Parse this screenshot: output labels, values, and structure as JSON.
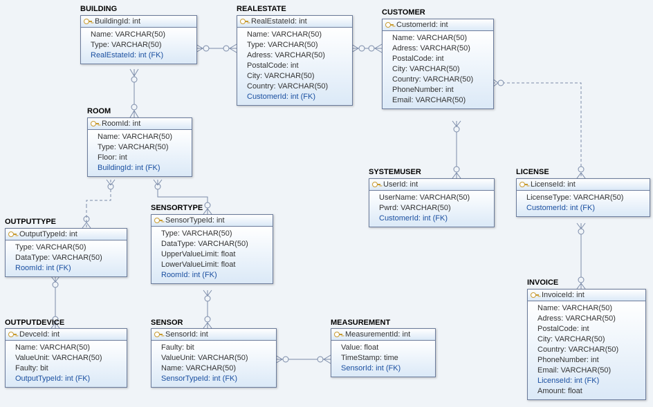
{
  "entities": {
    "building": {
      "title": "BUILDING",
      "pk": "BuildingId: int",
      "cols": [
        {
          "text": "Name: VARCHAR(50)",
          "fk": false
        },
        {
          "text": "Type: VARCHAR(50)",
          "fk": false
        },
        {
          "text": "RealEstateId: int (FK)",
          "fk": true
        }
      ]
    },
    "realestate": {
      "title": "REALESTATE",
      "pk": "RealEstateId: int",
      "cols": [
        {
          "text": "Name: VARCHAR(50)",
          "fk": false
        },
        {
          "text": "Type: VARCHAR(50)",
          "fk": false
        },
        {
          "text": "Adress: VARCHAR(50)",
          "fk": false
        },
        {
          "text": "PostalCode: int",
          "fk": false
        },
        {
          "text": "City: VARCHAR(50)",
          "fk": false
        },
        {
          "text": "Country: VARCHAR(50)",
          "fk": false
        },
        {
          "text": "CustomerId: int (FK)",
          "fk": true
        }
      ]
    },
    "customer": {
      "title": "CUSTOMER",
      "pk": "CustomerId: int",
      "cols": [
        {
          "text": "Name: VARCHAR(50)",
          "fk": false
        },
        {
          "text": "Adress: VARCHAR(50)",
          "fk": false
        },
        {
          "text": "PostalCode: int",
          "fk": false
        },
        {
          "text": "City: VARCHAR(50)",
          "fk": false
        },
        {
          "text": "Country: VARCHAR(50)",
          "fk": false
        },
        {
          "text": "PhoneNumber: int",
          "fk": false
        },
        {
          "text": "Email: VARCHAR(50)",
          "fk": false
        }
      ]
    },
    "room": {
      "title": "ROOM",
      "pk": "RoomId: int",
      "cols": [
        {
          "text": "Name: VARCHAR(50)",
          "fk": false
        },
        {
          "text": "Type: VARCHAR(50)",
          "fk": false
        },
        {
          "text": "Floor: int",
          "fk": false
        },
        {
          "text": "BuildingId: int (FK)",
          "fk": true
        }
      ]
    },
    "outputtype": {
      "title": "OUTPUTTYPE",
      "pk": "OutputTypeId: int",
      "cols": [
        {
          "text": "Type: VARCHAR(50)",
          "fk": false
        },
        {
          "text": "DataType: VARCHAR(50)",
          "fk": false
        },
        {
          "text": "RoomId: int (FK)",
          "fk": true
        }
      ]
    },
    "sensortype": {
      "title": "SENSORTYPE",
      "pk": "SensorTypeId: int",
      "cols": [
        {
          "text": "Type: VARCHAR(50)",
          "fk": false
        },
        {
          "text": "DataType: VARCHAR(50)",
          "fk": false
        },
        {
          "text": "UpperValueLimit: float",
          "fk": false
        },
        {
          "text": "LowerValueLimit: float",
          "fk": false
        },
        {
          "text": "RoomId: int (FK)",
          "fk": true
        }
      ]
    },
    "systemuser": {
      "title": "SYSTEMUSER",
      "pk": "UserId: int",
      "cols": [
        {
          "text": "UserName: VARCHAR(50)",
          "fk": false
        },
        {
          "text": "Pwrd: VARCHAR(50)",
          "fk": false
        },
        {
          "text": "CustomerId: int (FK)",
          "fk": true
        }
      ]
    },
    "license": {
      "title": "LICENSE",
      "pk": "LicenseId: int",
      "cols": [
        {
          "text": "LicenseType: VARCHAR(50)",
          "fk": false
        },
        {
          "text": "CustomerId: int (FK)",
          "fk": true
        }
      ]
    },
    "outputdevice": {
      "title": "OUTPUTDEVICE",
      "pk": "DevceId: int",
      "cols": [
        {
          "text": "Name: VARCHAR(50)",
          "fk": false
        },
        {
          "text": "ValueUnit: VARCHAR(50)",
          "fk": false
        },
        {
          "text": "Faulty: bit",
          "fk": false
        },
        {
          "text": "OutputTypeId: int (FK)",
          "fk": true
        }
      ]
    },
    "sensor": {
      "title": "SENSOR",
      "pk": "SensorId: int",
      "cols": [
        {
          "text": "Faulty: bit",
          "fk": false
        },
        {
          "text": "ValueUnit: VARCHAR(50)",
          "fk": false
        },
        {
          "text": "Name: VARCHAR(50)",
          "fk": false
        },
        {
          "text": "SensorTypeId: int (FK)",
          "fk": true
        }
      ]
    },
    "measurement": {
      "title": "MEASUREMENT",
      "pk": "MeasurementId: int",
      "cols": [
        {
          "text": "Value: float",
          "fk": false
        },
        {
          "text": "TimeStamp: time",
          "fk": false
        },
        {
          "text": "SensorId: int (FK)",
          "fk": true
        }
      ]
    },
    "invoice": {
      "title": "INVOICE",
      "pk": "InvoiceId: int",
      "cols": [
        {
          "text": "Name: VARCHAR(50)",
          "fk": false
        },
        {
          "text": "Adress: VARCHAR(50)",
          "fk": false
        },
        {
          "text": "PostalCode: int",
          "fk": false
        },
        {
          "text": "City: VARCHAR(50)",
          "fk": false
        },
        {
          "text": "Country: VARCHAR(50)",
          "fk": false
        },
        {
          "text": "PhoneNumber: int",
          "fk": false
        },
        {
          "text": "Email: VARCHAR(50)",
          "fk": false
        },
        {
          "text": "LicenseId: int (FK)",
          "fk": true
        },
        {
          "text": "Amount: float",
          "fk": false
        }
      ]
    }
  }
}
